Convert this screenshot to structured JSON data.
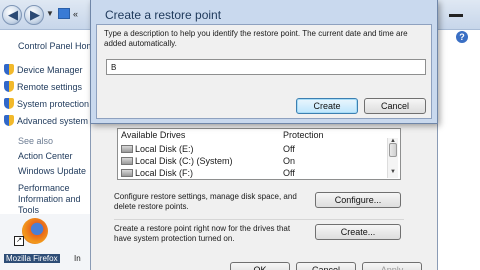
{
  "explorer": {
    "address_text": "«",
    "sidebar": {
      "home_link": "Control Panel Home",
      "tasks": [
        {
          "label": "Device Manager"
        },
        {
          "label": "Remote settings"
        },
        {
          "label": "System protection"
        },
        {
          "label": "Advanced system settings"
        }
      ],
      "see_also": "See also",
      "links": [
        {
          "label": "Action Center"
        },
        {
          "label": "Windows Update"
        },
        {
          "label": "Performance Information and Tools"
        }
      ]
    },
    "help_glyph": "?"
  },
  "system_protection": {
    "drives_header": "Available Drives",
    "protection_header": "Protection",
    "drives": [
      {
        "name": "Local Disk (E:)",
        "protection": "Off"
      },
      {
        "name": "Local Disk (C:) (System)",
        "protection": "On"
      },
      {
        "name": "Local Disk (F:)",
        "protection": "Off"
      }
    ],
    "configure_text": "Configure restore settings, manage disk space, and delete restore points.",
    "configure_button": "Configure...",
    "create_text": "Create a restore point right now for the drives that have system protection turned on.",
    "create_button": "Create...",
    "ok_button": "OK",
    "cancel_button": "Cancel",
    "apply_button": "Apply"
  },
  "restore_dialog": {
    "title": "Create a restore point",
    "instruction": "Type a description to help you identify the restore point. The current date and time are added automatically.",
    "input_value": "B",
    "create_button": "Create",
    "cancel_button": "Cancel"
  },
  "desktop": {
    "firefox_label": "Mozilla Firefox",
    "firefox_label_suffix": "In"
  },
  "colors": {
    "dialog_frame": "#c9d9ee",
    "link_blue": "#1e395b",
    "default_button_border": "#3c7fb1"
  }
}
